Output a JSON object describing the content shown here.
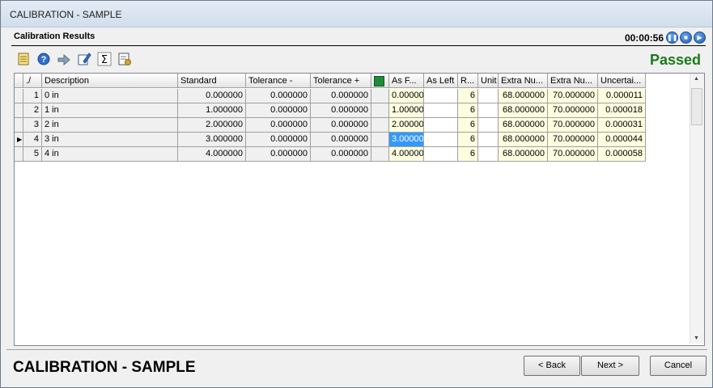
{
  "window": {
    "title": "CALIBRATION - SAMPLE"
  },
  "section": {
    "title": "Calibration Results",
    "timer": "00:00:56",
    "status": "Passed",
    "status_color": "#1a7a1a"
  },
  "toolbar": {
    "icons": [
      "notes-icon",
      "help-icon",
      "forward-icon",
      "edit-icon",
      "sum-icon",
      "report-icon"
    ]
  },
  "grid": {
    "headers": [
      "./",
      "Description",
      "Standard",
      "Tolerance -",
      "Tolerance +",
      "",
      "As F...",
      "As Left",
      "R...",
      "Unit",
      "Extra Nu...",
      "Extra Nu...",
      "Uncertai..."
    ],
    "rows": [
      {
        "n": "1",
        "desc": "0 in",
        "std": "0.000000",
        "tolm": "0.000000",
        "tolp": "0.000000",
        "asf": "0.00000",
        "asl": "",
        "r": "6",
        "unit": "",
        "x1": "68.000000",
        "x2": "70.000000",
        "unc": "0.000011"
      },
      {
        "n": "2",
        "desc": "1 in",
        "std": "1.000000",
        "tolm": "0.000000",
        "tolp": "0.000000",
        "asf": "1.00000",
        "asl": "",
        "r": "6",
        "unit": "",
        "x1": "68.000000",
        "x2": "70.000000",
        "unc": "0.000018"
      },
      {
        "n": "3",
        "desc": "2 in",
        "std": "2.000000",
        "tolm": "0.000000",
        "tolp": "0.000000",
        "asf": "2.00000",
        "asl": "",
        "r": "6",
        "unit": "",
        "x1": "68.000000",
        "x2": "70.000000",
        "unc": "0.000031"
      },
      {
        "n": "4",
        "desc": "3 in",
        "std": "3.000000",
        "tolm": "0.000000",
        "tolp": "0.000000",
        "asf": "3.00000",
        "asl": "",
        "r": "6",
        "unit": "",
        "x1": "68.000000",
        "x2": "70.000000",
        "unc": "0.000044"
      },
      {
        "n": "5",
        "desc": "4 in",
        "std": "4.000000",
        "tolm": "0.000000",
        "tolp": "0.000000",
        "asf": "4.00000",
        "asl": "",
        "r": "6",
        "unit": "",
        "x1": "68.000000",
        "x2": "70.000000",
        "unc": "0.000058"
      }
    ]
  },
  "footer": {
    "title": "CALIBRATION - SAMPLE",
    "back": "< Back",
    "next": "Next >",
    "cancel": "Cancel"
  }
}
